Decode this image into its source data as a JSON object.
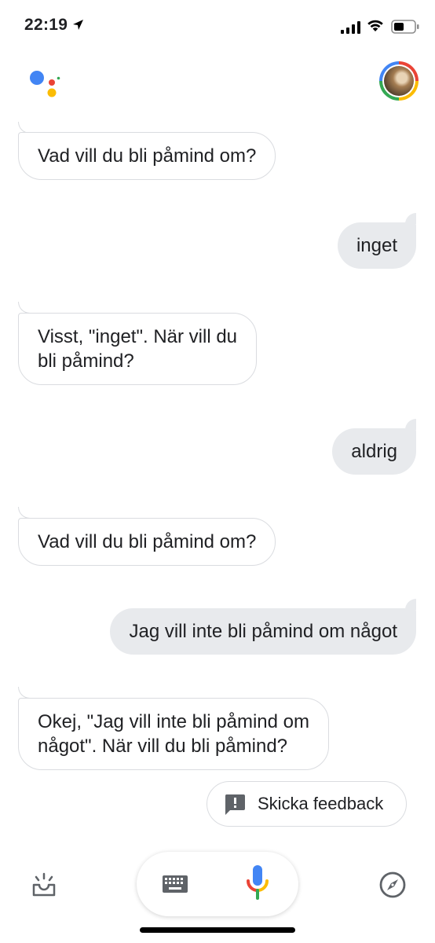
{
  "status_bar": {
    "time": "22:19",
    "icons": [
      "location-arrow-icon",
      "cellular-signal-icon",
      "wifi-icon",
      "battery-icon"
    ]
  },
  "header": {
    "logo": "google-assistant-logo",
    "avatar": "user-avatar"
  },
  "conversation": [
    {
      "role": "assistant",
      "lines": [
        "Vad vill du bli påmind om?"
      ]
    },
    {
      "role": "user",
      "lines": [
        "inget"
      ]
    },
    {
      "role": "assistant",
      "lines": [
        "Visst, \"inget\". När vill du",
        "bli påmind?"
      ]
    },
    {
      "role": "user",
      "lines": [
        "aldrig"
      ]
    },
    {
      "role": "assistant",
      "lines": [
        "Vad vill du bli påmind om?"
      ]
    },
    {
      "role": "user",
      "lines": [
        "Jag vill inte bli påmind om något"
      ]
    },
    {
      "role": "assistant",
      "lines": [
        "Okej, \"Jag vill inte bli påmind om",
        "något\". När vill du bli påmind?"
      ]
    }
  ],
  "feedback_chip": {
    "label": "Skicka feedback",
    "icon": "feedback-icon"
  },
  "bottom_bar": {
    "icons": [
      "updates-icon",
      "keyboard-icon",
      "microphone-icon",
      "explore-compass-icon"
    ]
  },
  "colors": {
    "google_blue": "#4285f4",
    "google_red": "#ea4335",
    "google_yellow": "#fbbc04",
    "google_green": "#34a853",
    "user_bubble": "#e8eaed",
    "border": "#dadce0"
  }
}
